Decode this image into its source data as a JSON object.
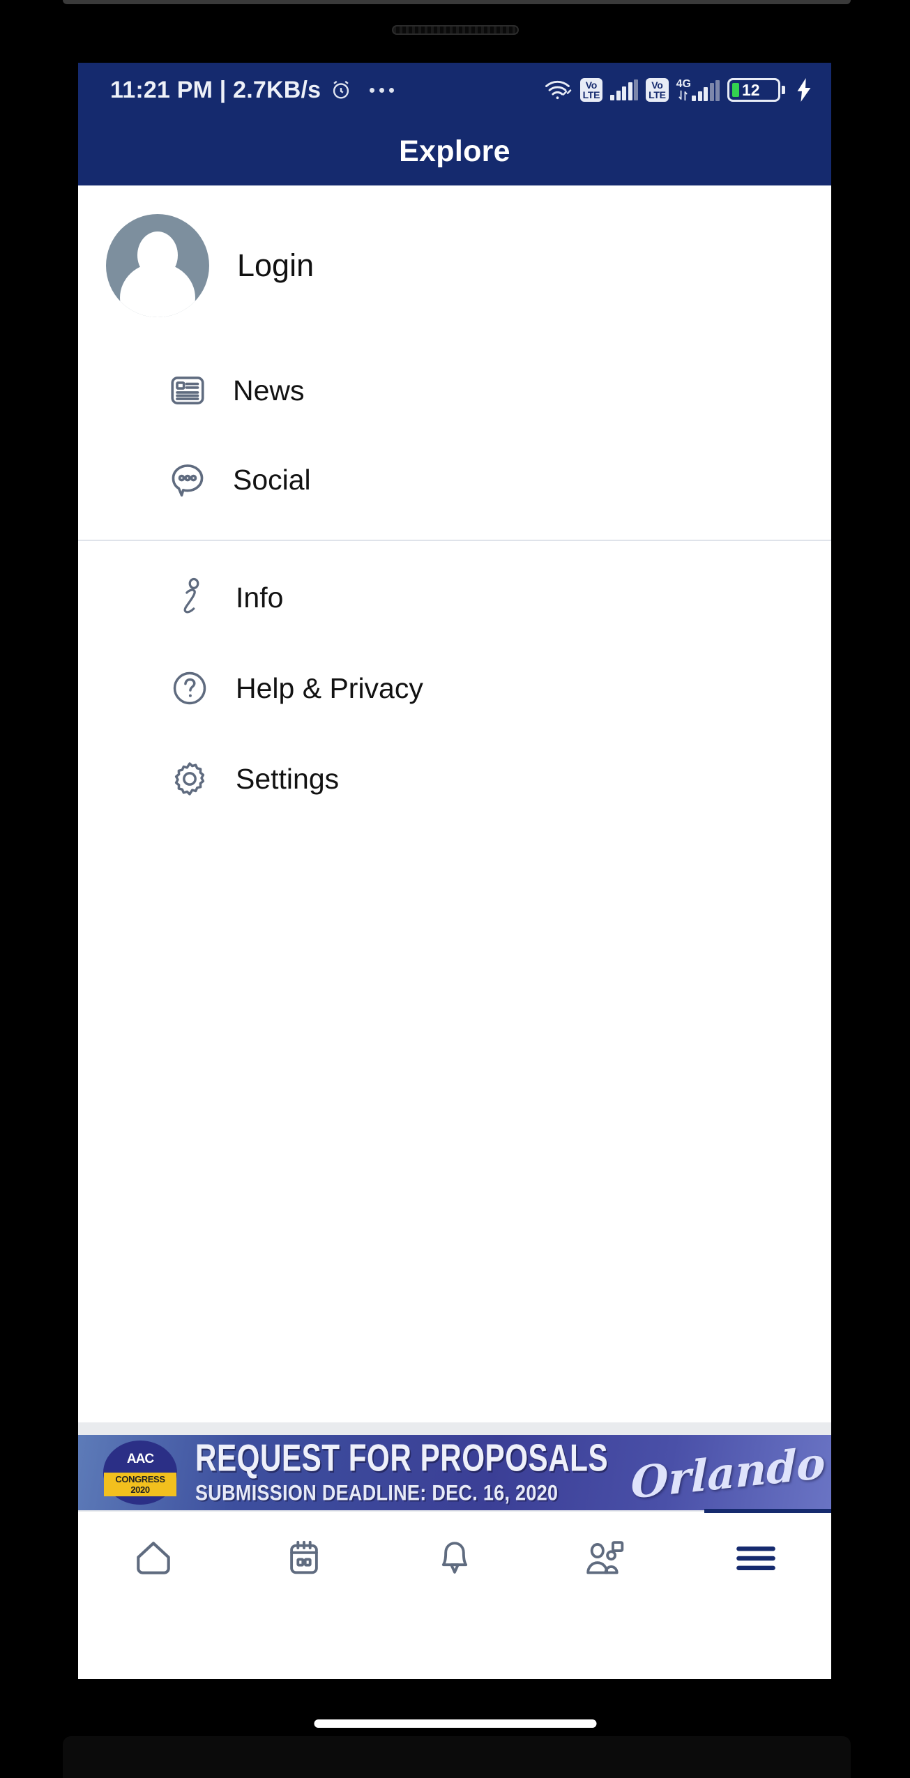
{
  "status_bar": {
    "clock": "11:21 PM | 2.7KB/s",
    "alarm_icon": "alarm-clock-icon",
    "overflow_icon": "three-dots-icon",
    "wifi_icon": "wifi-icon",
    "sim1_volte": "Vo",
    "sim1_volte2": "LTE",
    "sim2_volte": "Vo",
    "sim2_volte2": "LTE",
    "network_type": "4G",
    "battery_percent": "12",
    "battery_color": "#33d14f",
    "charging_icon": "lightning-bolt-icon"
  },
  "app_bar": {
    "title": "Explore",
    "background": "#152a6e"
  },
  "account": {
    "label": "Login",
    "avatar_icon": "user-avatar-icon",
    "avatar_color": "#7d8f9e"
  },
  "menu": {
    "group1": [
      {
        "label": "News",
        "icon": "newspaper-icon"
      },
      {
        "label": "Social",
        "icon": "chat-bubble-icon"
      }
    ],
    "group2": [
      {
        "label": "Info",
        "icon": "info-icon"
      },
      {
        "label": "Help & Privacy",
        "icon": "question-circle-icon"
      },
      {
        "label": "Settings",
        "icon": "gear-icon"
      }
    ]
  },
  "banner": {
    "logo_text": "AAC",
    "logo_badge": "CONGRESS 2020",
    "headline": "REQUEST FOR PROPOSALS",
    "subline": "SUBMISSION DEADLINE: DEC. 16, 2020",
    "city": "Orlando"
  },
  "bottom_nav": {
    "items": [
      {
        "name": "home",
        "icon": "home-icon",
        "active": false
      },
      {
        "name": "calendar",
        "icon": "calendar-icon",
        "active": false
      },
      {
        "name": "notifications",
        "icon": "bell-icon",
        "active": false
      },
      {
        "name": "attendees",
        "icon": "people-icon",
        "active": false
      },
      {
        "name": "more",
        "icon": "hamburger-menu-icon",
        "active": true
      }
    ],
    "active_color": "#152a6e",
    "inactive_color": "#5f6b7f"
  }
}
